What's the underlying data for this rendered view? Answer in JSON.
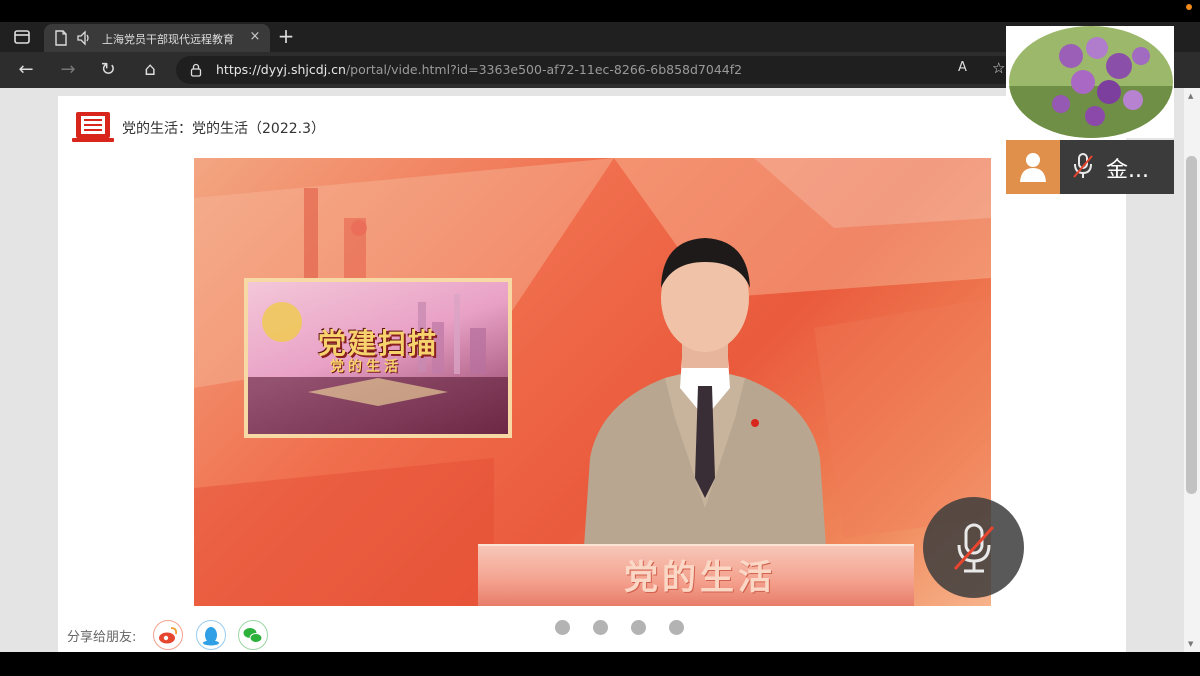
{
  "browser": {
    "tab_title": "上海党员干部现代远程教育",
    "tab_close": "×",
    "new_tab": "+",
    "url_host": "https://dyyj.shjcdj.cn",
    "url_path": "/portal/vide.html?id=3363e500-af72-11ec-8266-6b858d7044f2",
    "read_aloud": "A",
    "nav": {
      "back": "←",
      "forward": "→",
      "refresh": "↻",
      "home": "⌂"
    }
  },
  "page": {
    "heading": "党的生活：党的生活（2022.3）",
    "share_label": "分享给朋友:"
  },
  "video": {
    "inset_title": "党建扫描",
    "inset_subtitle": "党的生活",
    "desk_text": "党的生活"
  },
  "meeting": {
    "user_name": "金...",
    "carousel_dots": 4
  },
  "colors": {
    "accent_red": "#d9261c",
    "user_badge": "#e0904a",
    "weibo": "#e6462e",
    "qq": "#2fa0e6",
    "wechat": "#2cb13b"
  }
}
